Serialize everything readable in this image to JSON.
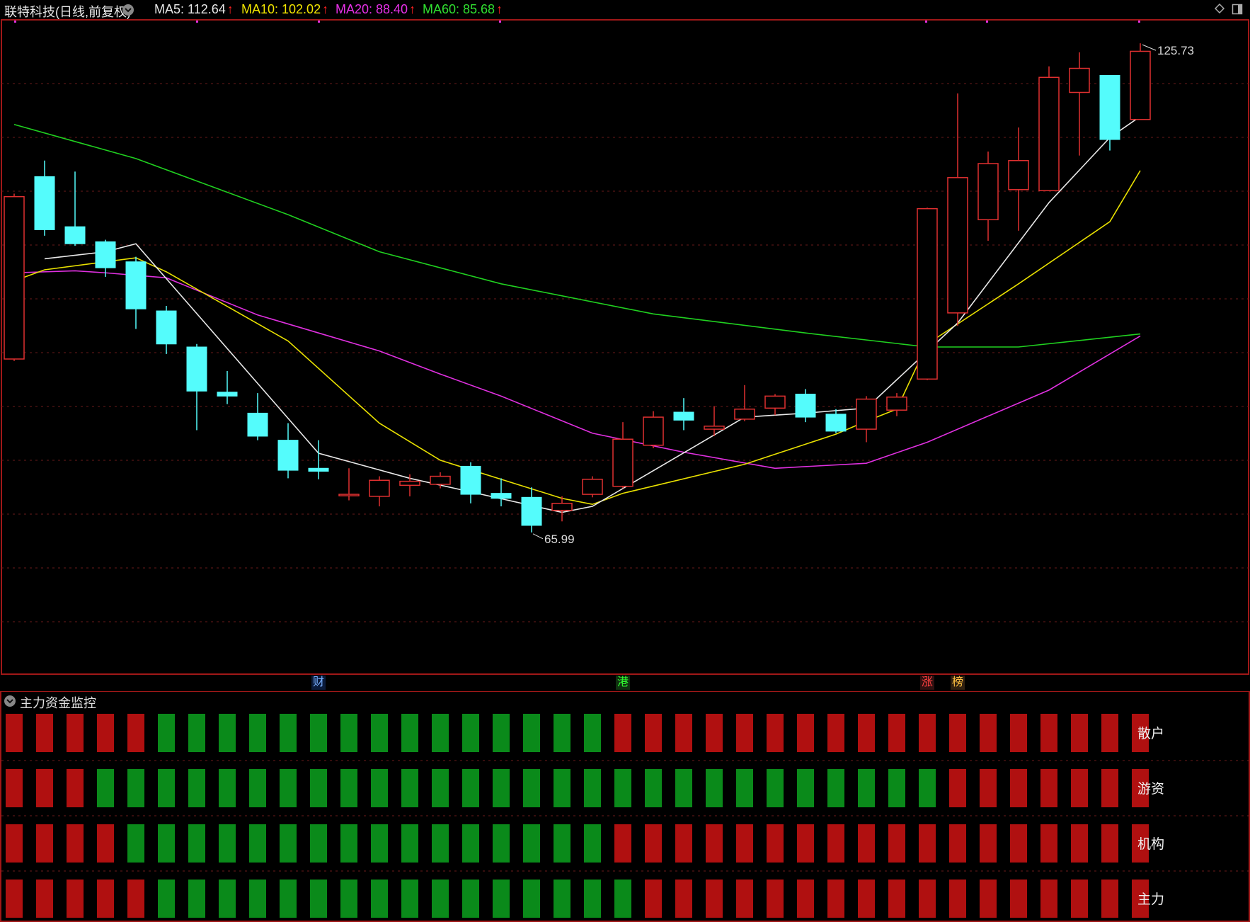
{
  "header": {
    "title": "联特科技(日线,前复权)",
    "indicators": [
      {
        "label": "MA5: 112.64",
        "color": "#e8e8e8"
      },
      {
        "label": "MA10: 102.02",
        "color": "#f2e600"
      },
      {
        "label": "MA20: 88.40",
        "color": "#e830e8"
      },
      {
        "label": "MA60: 85.68",
        "color": "#30e030"
      }
    ],
    "arrow": "↑"
  },
  "colors": {
    "up": "#e03030",
    "down": "#54fcfc",
    "ma5": "#e8e8e8",
    "ma10": "#e8e000",
    "ma20": "#e030e0",
    "ma60": "#20d020",
    "bar_red": "#b01010",
    "bar_green": "#0a8a1a",
    "grid": "#6a1a1a"
  },
  "price_chart": {
    "high_label": "125.73",
    "low_label": "65.99",
    "markers": [
      {
        "text": "财",
        "color": "#7ab0ff",
        "bg": "#0a1a3a",
        "index": 10
      },
      {
        "text": "港",
        "color": "#30ff30",
        "bg": "#103010",
        "index": 20
      },
      {
        "text": "涨",
        "color": "#ff4040",
        "bg": "#301010",
        "index": 30
      },
      {
        "text": "榜",
        "color": "#ffc040",
        "bg": "#302010",
        "index": 31
      }
    ]
  },
  "chart_data": {
    "type": "candlestick",
    "y_range": [
      63,
      128
    ],
    "candles": [
      {
        "o": 94.3,
        "c": 110.5,
        "h": 110.8,
        "l": 94.1
      },
      {
        "o": 112.5,
        "c": 107.2,
        "h": 114.1,
        "l": 106.6
      },
      {
        "o": 107.5,
        "c": 105.8,
        "h": 113.0,
        "l": 105.6
      },
      {
        "o": 106.0,
        "c": 103.4,
        "h": 106.2,
        "l": 102.5
      },
      {
        "o": 104.0,
        "c": 99.3,
        "h": 104.5,
        "l": 97.3
      },
      {
        "o": 99.1,
        "c": 95.8,
        "h": 99.6,
        "l": 94.8
      },
      {
        "o": 95.5,
        "c": 91.1,
        "h": 95.8,
        "l": 87.2
      },
      {
        "o": 91.0,
        "c": 90.6,
        "h": 93.1,
        "l": 89.8
      },
      {
        "o": 88.9,
        "c": 86.6,
        "h": 90.9,
        "l": 86.2
      },
      {
        "o": 86.2,
        "c": 83.2,
        "h": 87.9,
        "l": 82.4
      },
      {
        "o": 83.4,
        "c": 83.1,
        "h": 86.2,
        "l": 82.3
      },
      {
        "o": 80.8,
        "c": 80.8,
        "h": 83.4,
        "l": 80.2
      },
      {
        "o": 80.6,
        "c": 82.2,
        "h": 82.6,
        "l": 79.6
      },
      {
        "o": 81.7,
        "c": 82.1,
        "h": 82.8,
        "l": 80.6
      },
      {
        "o": 81.8,
        "c": 82.6,
        "h": 83.0,
        "l": 81.4
      },
      {
        "o": 83.6,
        "c": 80.8,
        "h": 84.0,
        "l": 79.9
      },
      {
        "o": 80.9,
        "c": 80.4,
        "h": 82.4,
        "l": 79.6
      },
      {
        "o": 80.5,
        "c": 77.7,
        "h": 81.5,
        "l": 77.0
      },
      {
        "o": 79.2,
        "c": 79.9,
        "h": 80.6,
        "l": 78.1
      },
      {
        "o": 80.8,
        "c": 82.3,
        "h": 82.6,
        "l": 80.5
      },
      {
        "o": 81.6,
        "c": 86.3,
        "h": 88.0,
        "l": 81.4
      },
      {
        "o": 85.7,
        "c": 88.5,
        "h": 89.1,
        "l": 85.4
      },
      {
        "o": 89.0,
        "c": 88.2,
        "h": 90.4,
        "l": 87.2
      },
      {
        "o": 87.3,
        "c": 87.6,
        "h": 89.6,
        "l": 86.6
      },
      {
        "o": 88.3,
        "c": 89.3,
        "h": 91.7,
        "l": 88.1
      },
      {
        "o": 89.4,
        "c": 90.6,
        "h": 90.8,
        "l": 88.7
      },
      {
        "o": 90.8,
        "c": 88.5,
        "h": 91.3,
        "l": 88.0
      },
      {
        "o": 88.8,
        "c": 87.1,
        "h": 89.3,
        "l": 86.9
      },
      {
        "o": 87.3,
        "c": 90.3,
        "h": 90.6,
        "l": 86.0
      },
      {
        "o": 89.2,
        "c": 90.5,
        "h": 90.9,
        "l": 88.6
      },
      {
        "o": 92.3,
        "c": 109.3,
        "h": 109.4,
        "l": 92.2
      },
      {
        "o": 98.9,
        "c": 112.4,
        "h": 120.8,
        "l": 97.6
      },
      {
        "o": 108.2,
        "c": 113.8,
        "h": 115.0,
        "l": 106.1
      },
      {
        "o": 111.2,
        "c": 114.1,
        "h": 117.4,
        "l": 107.1
      },
      {
        "o": 111.1,
        "c": 122.4,
        "h": 123.5,
        "l": 111.1
      },
      {
        "o": 120.9,
        "c": 123.3,
        "h": 124.9,
        "l": 114.6
      },
      {
        "o": 122.6,
        "c": 116.2,
        "h": 122.6,
        "l": 115.1
      },
      {
        "o": 118.2,
        "c": 125.0,
        "h": 125.8,
        "l": 118.2
      }
    ],
    "ma5": [
      null,
      104.3,
      null,
      105.0,
      105.8,
      null,
      null,
      null,
      null,
      null,
      84.9,
      null,
      null,
      82.4,
      null,
      null,
      null,
      null,
      79.0,
      79.6,
      null,
      null,
      null,
      null,
      88.5,
      null,
      88.9,
      null,
      89.4,
      null,
      null,
      97.9,
      null,
      null,
      109.9,
      null,
      116.4,
      118.5
    ],
    "ma10": [
      102.1,
      103.2,
      null,
      null,
      104.4,
      103.0,
      null,
      null,
      null,
      96.1,
      null,
      null,
      87.9,
      null,
      84.2,
      null,
      null,
      null,
      80.4,
      79.8,
      80.9,
      null,
      null,
      null,
      83.8,
      null,
      null,
      86.8,
      88.1,
      89.3,
      95.8,
      null,
      null,
      101.8,
      null,
      null,
      108.0,
      113.1
    ],
    "ma20": [
      102.9,
      null,
      103.1,
      102.9,
      null,
      102.4,
      null,
      null,
      98.7,
      null,
      96.9,
      null,
      95.1,
      null,
      92.8,
      null,
      90.6,
      null,
      null,
      86.9,
      null,
      null,
      85.0,
      null,
      null,
      83.4,
      null,
      null,
      83.9,
      null,
      86.0,
      null,
      null,
      null,
      91.2,
      null,
      null,
      96.6
    ],
    "ma60": [
      [
        0,
        117.7
      ],
      [
        4,
        114.3
      ],
      [
        9,
        108.7
      ],
      [
        12,
        105.0
      ],
      [
        16,
        101.8
      ],
      [
        21,
        98.8
      ],
      [
        26,
        96.9
      ],
      [
        30,
        95.5
      ],
      [
        33,
        95.5
      ],
      [
        37,
        96.8
      ]
    ],
    "ma_series_x_note": ""
  },
  "money_flow": {
    "title": "主力资金监控",
    "rows": [
      {
        "label": "散户",
        "colors": "RRRRRGGGGGGGGGGGGGGGRRRRRRRRRRRRRRRRRR"
      },
      {
        "label": "游资",
        "colors": "RRRGGGGGGGGGGGGGGGGGGGGGGGGGGGGRRRRRRR"
      },
      {
        "label": "机构",
        "colors": "RRRRGGGGGGGGGGGGGGGGRRRRRRRRRRRRRRRRRR"
      },
      {
        "label": "主力",
        "colors": "RRRRRGGGGGGGGGGGGGGGGRRRRRRRRRRRRRRRRR"
      }
    ]
  }
}
